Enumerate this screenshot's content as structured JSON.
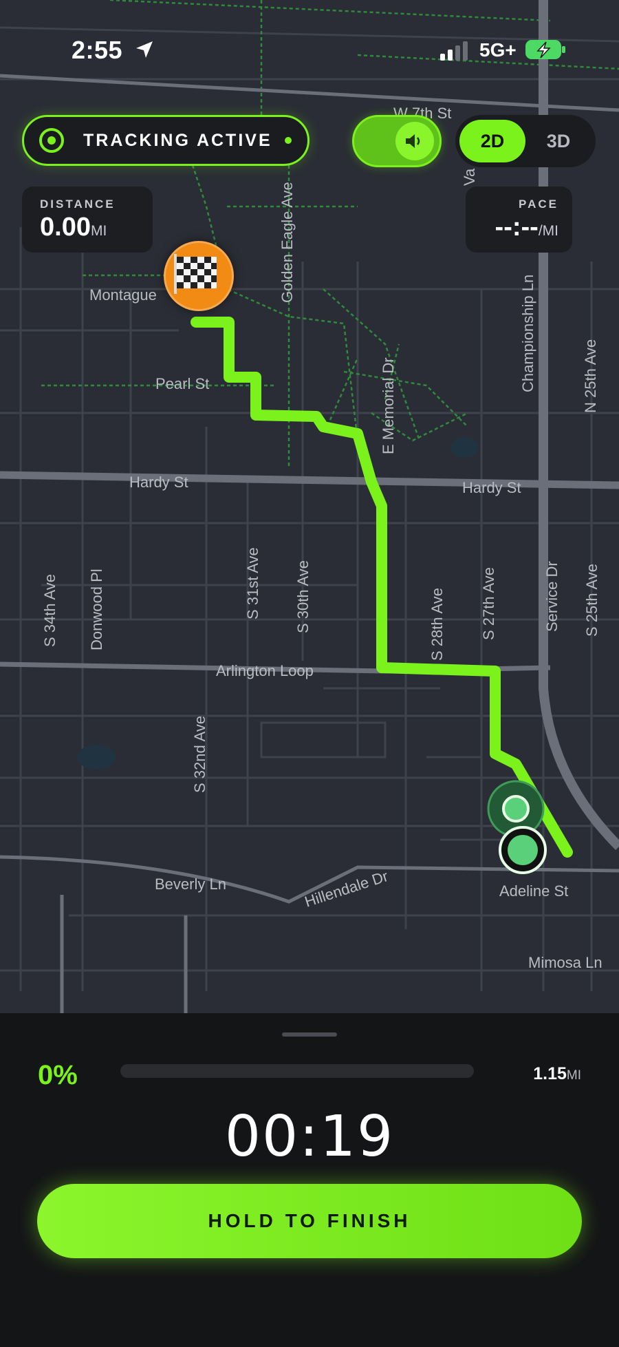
{
  "status_bar": {
    "time": "2:55",
    "network": "5G+",
    "icons": [
      "location-arrow-icon",
      "signal-icon",
      "battery-charging-icon"
    ]
  },
  "controls": {
    "tracking_label": "TRACKING ACTIVE",
    "sound_icon": "speaker-icon",
    "view_2d": "2D",
    "view_3d": "3D",
    "active_view": "2D"
  },
  "stats": {
    "distance_caption": "DISTANCE",
    "distance_value": "0.00",
    "distance_unit": "MI",
    "pace_caption": "PACE",
    "pace_value": "--:--",
    "pace_unit": "/MI"
  },
  "map": {
    "streets": [
      "W 7th St",
      "Montague",
      "Golden Eagle Ave",
      "Pearl St",
      "E Memorial Dr",
      "Championship Ln",
      "N 25th Ave",
      "Hardy St",
      "Hardy St",
      "S 34th Ave",
      "Donwood Pl",
      "S 31st Ave",
      "S 30th Ave",
      "S 28th Ave",
      "S 27th Ave",
      "Service Dr",
      "S 25th Ave",
      "Arlington Loop",
      "S 32nd Ave",
      "Beverly Ln",
      "Hillendale Dr",
      "Adeline St",
      "Mimosa Ln",
      "Va"
    ],
    "route_color": "#7cf21c",
    "finish_icon": "checkered-flag-icon"
  },
  "progress": {
    "percent_label": "0%",
    "fraction": 0,
    "total_distance": "1.15",
    "total_unit": "MI"
  },
  "timer": "00:19",
  "finish_button": "HOLD TO FINISH"
}
